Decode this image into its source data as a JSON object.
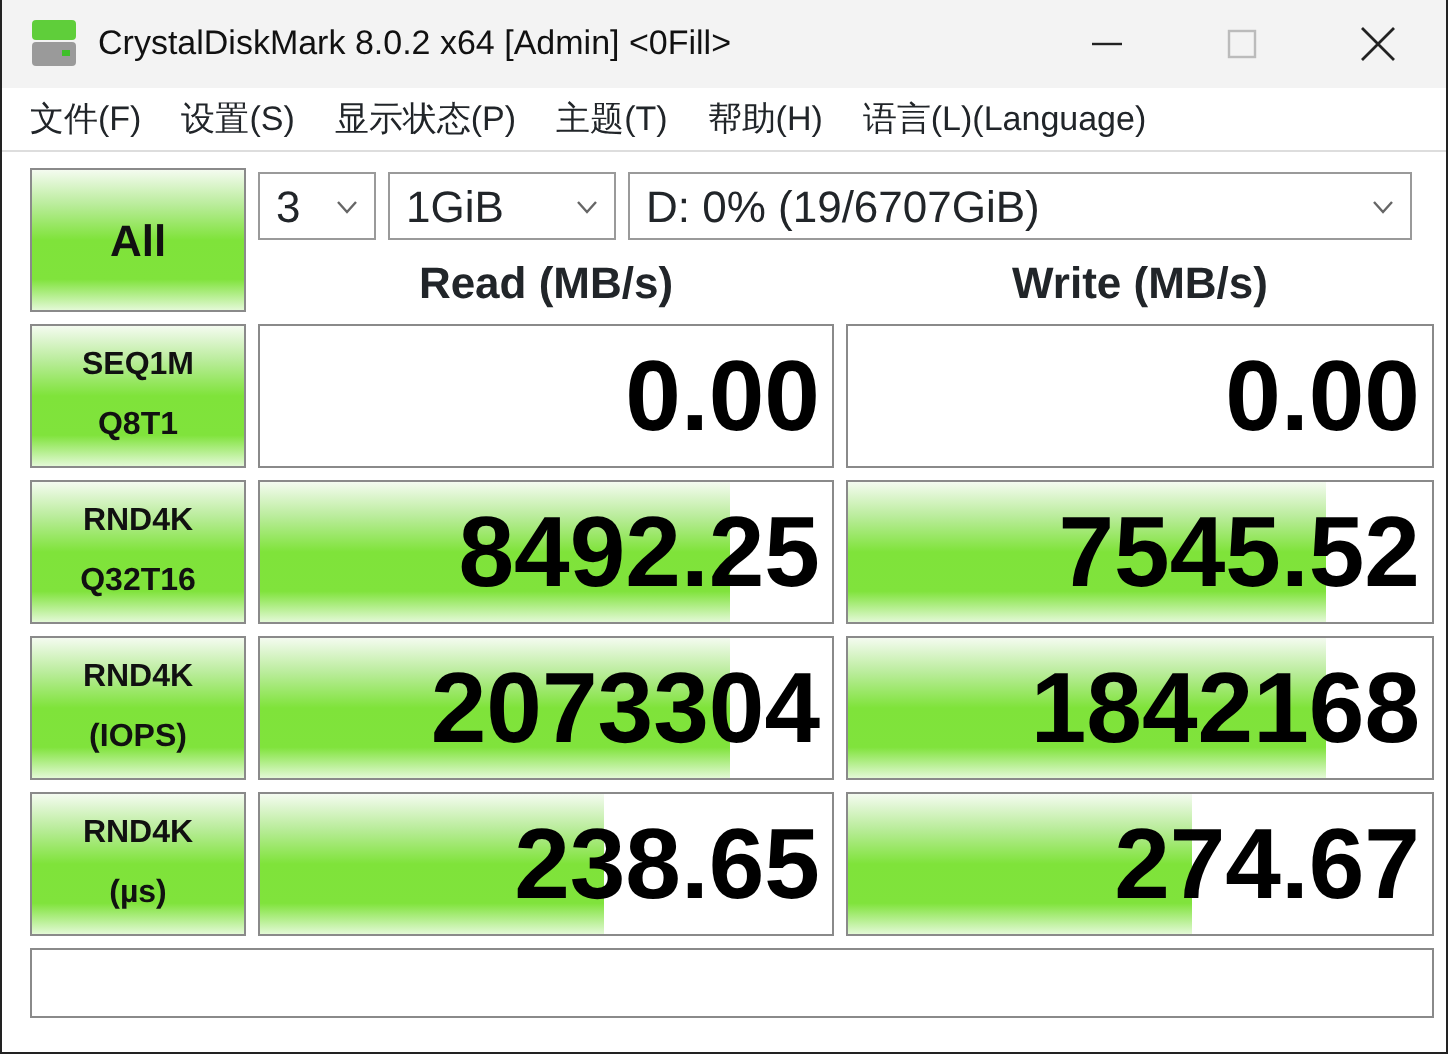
{
  "window": {
    "title": "CrystalDiskMark 8.0.2 x64 [Admin] <0Fill>"
  },
  "menu": [
    "文件(F)",
    "设置(S)",
    "显示状态(P)",
    "主题(T)",
    "帮助(H)",
    "语言(L)(Language)"
  ],
  "all_button": "All",
  "dropdowns": [
    {
      "value": "3"
    },
    {
      "value": "1GiB"
    },
    {
      "value": "D: 0% (19/6707GiB)"
    }
  ],
  "columns": [
    "Read (MB/s)",
    "Write (MB/s)"
  ],
  "rows": [
    {
      "label": [
        "SEQ1M",
        "Q8T1"
      ],
      "read": {
        "value": "0.00"
      },
      "write": {
        "value": "0.00"
      }
    },
    {
      "label": [
        "RND4K",
        "Q32T16"
      ],
      "read": {
        "value": "8492.25",
        "level": 0.82
      },
      "write": {
        "value": "7545.52",
        "level": 0.82
      }
    },
    {
      "label": [
        "RND4K",
        "(IOPS)"
      ],
      "read": {
        "value": "2073304",
        "level": 0.82
      },
      "write": {
        "value": "1842168",
        "level": 0.82
      }
    },
    {
      "label": [
        "RND4K",
        "(µs)"
      ],
      "read": {
        "value": "238.65",
        "level": 0.6
      },
      "write": {
        "value": "274.67",
        "level": 0.59
      }
    }
  ]
}
